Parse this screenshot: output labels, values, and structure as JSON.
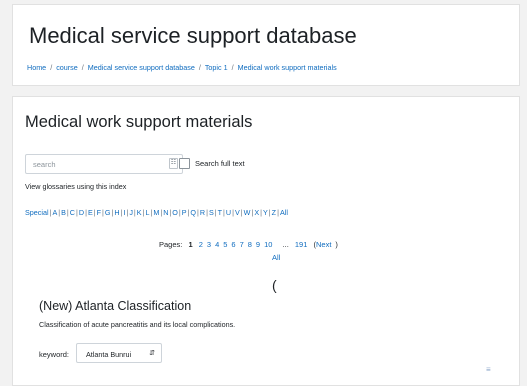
{
  "header": {
    "title": "Medical service support database",
    "breadcrumb": [
      "Home",
      "course",
      "Medical service support database",
      "Topic 1",
      "Medical work support materials"
    ]
  },
  "main": {
    "title": "Medical work support materials",
    "search": {
      "placeholder": "search",
      "value": ""
    },
    "search_full_text_label": "Search full text",
    "view_glossaries_label": "View glossaries using this index",
    "alphabet": [
      "Special",
      "A",
      "B",
      "C",
      "D",
      "E",
      "F",
      "G",
      "H",
      "I",
      "J",
      "K",
      "L",
      "M",
      "N",
      "O",
      "P",
      "Q",
      "R",
      "S",
      "T",
      "U",
      "V",
      "W",
      "X",
      "Y",
      "Z",
      "All"
    ],
    "pagination": {
      "label": "Pages:",
      "current": "1",
      "pages": [
        "2",
        "3",
        "4",
        "5",
        "6",
        "7",
        "8",
        "9",
        "10"
      ],
      "ellipsis": "...",
      "last": "191",
      "next_label": "Next",
      "all_label": "All"
    },
    "group_letter": "(",
    "entry": {
      "title": "(New) Atlanta Classification",
      "description": "Classification of acute pancreatitis and its local complications.",
      "keyword_label": "keyword:",
      "keyword_value": "Atlanta Bunrui"
    }
  },
  "colors": {
    "link": "#0f6cbf",
    "text": "#1d2125",
    "background": "#f2f2f2"
  },
  "icons": {
    "search_button": "search-icon",
    "select": "chevron-updown-icon",
    "corner": "collapse-icon"
  }
}
